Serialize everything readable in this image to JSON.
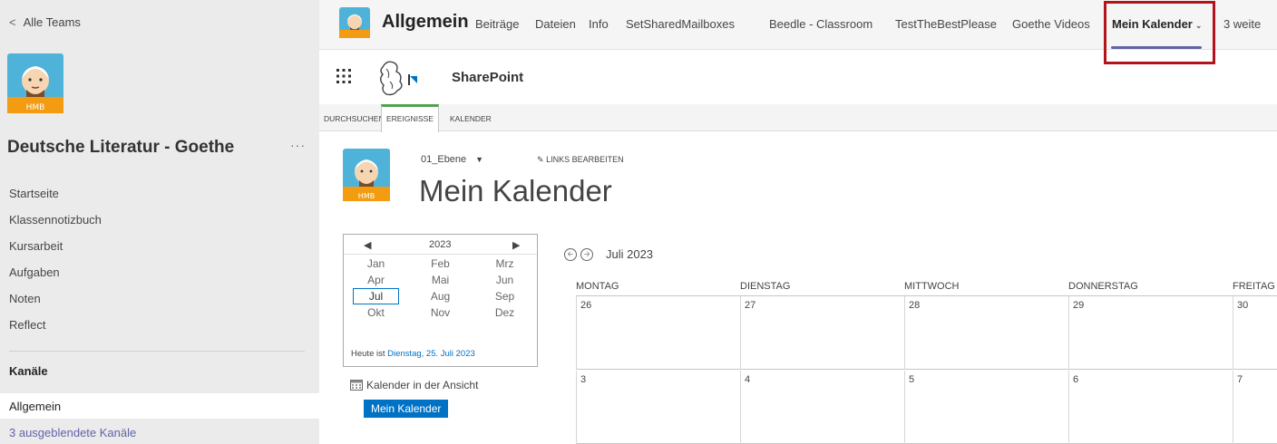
{
  "left": {
    "back_label": "Alle Teams",
    "team_name": "Deutsche Literatur - Goethe",
    "more": "···",
    "nav": [
      "Startseite",
      "Klassennotizbuch",
      "Kursarbeit",
      "Aufgaben",
      "Noten",
      "Reflect"
    ],
    "channels_heading": "Kanäle",
    "active_channel": "Allgemein",
    "hidden_channels": "3 ausgeblendete Kanäle"
  },
  "tabbar": {
    "channel": "Allgemein",
    "tabs": [
      "Beiträge",
      "Dateien",
      "Info",
      "SetSharedMailboxes",
      "Beedle - Classroom",
      "TestTheBestPlease",
      "Goethe Videos",
      "Mein Kalender",
      "3 weite"
    ],
    "active_tab": "Mein Kalender",
    "highlight_color": "#b3131a"
  },
  "sharepoint": {
    "title": "SharePoint"
  },
  "ribbon": {
    "tabs": [
      "DURCHSUCHEN",
      "EREIGNISSE",
      "KALENDER"
    ],
    "selected": "EREIGNISSE"
  },
  "page": {
    "breadcrumb": "01_Ebene",
    "edit_links": "LINKS BEARBEITEN",
    "title": "Mein Kalender"
  },
  "picker": {
    "year": "2023",
    "months": [
      "Jan",
      "Feb",
      "Mrz",
      "Apr",
      "Mai",
      "Jun",
      "Jul",
      "Aug",
      "Sep",
      "Okt",
      "Nov",
      "Dez"
    ],
    "selected_month": "Jul",
    "today_prefix": "Heute ist",
    "today_link": "Dienstag, 25. Juli 2023"
  },
  "calendars_in_view": "Kalender in der Ansicht",
  "calendar_chip": "Mein Kalender",
  "calendar": {
    "month_label": "Juli 2023",
    "weekdays": [
      "MONTAG",
      "DIENSTAG",
      "MITTWOCH",
      "DONNERSTAG",
      "FREITAG"
    ],
    "weeks": [
      [
        "26",
        "27",
        "28",
        "29",
        "30"
      ],
      [
        "3",
        "4",
        "5",
        "6",
        "7"
      ]
    ]
  },
  "colors": {
    "accent": "#6264a7",
    "sharepoint_blue": "#0072c6",
    "ribbon_green": "#51a351"
  }
}
